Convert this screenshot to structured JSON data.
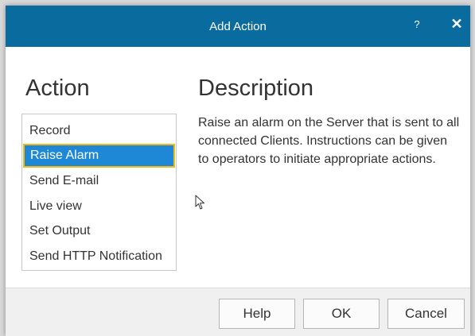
{
  "window": {
    "title": "Add Action",
    "help_label": "?",
    "close_label": "✕"
  },
  "action_panel": {
    "heading": "Action",
    "items": [
      {
        "label": "Record",
        "selected": false
      },
      {
        "label": "Raise Alarm",
        "selected": true
      },
      {
        "label": "Send E-mail",
        "selected": false
      },
      {
        "label": "Live view",
        "selected": false
      },
      {
        "label": "Set Output",
        "selected": false
      },
      {
        "label": "Send HTTP Notification",
        "selected": false
      }
    ]
  },
  "description_panel": {
    "heading": "Description",
    "text": "Raise an alarm on the Server that is sent to all connected Clients. Instructions can be given to operators to initiate appropriate actions."
  },
  "footer": {
    "help_button": "Help",
    "ok_button": "OK",
    "cancel_button": "Cancel"
  },
  "colors": {
    "titlebar": "#0a6b9e",
    "selection": "#1e88d6",
    "selection_border": "#f2b817"
  },
  "icons": {
    "pointer": "mouse-pointer-icon"
  }
}
